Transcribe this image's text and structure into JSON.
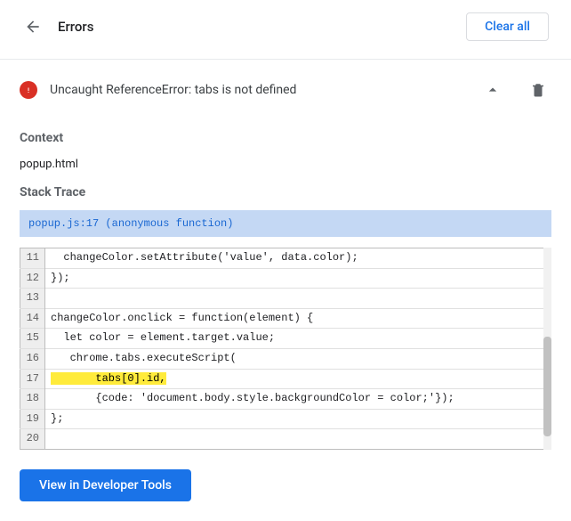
{
  "header": {
    "title": "Errors",
    "clear_all": "Clear all"
  },
  "error": {
    "message": "Uncaught ReferenceError: tabs is not defined",
    "context_heading": "Context",
    "context_file": "popup.html",
    "stack_heading": "Stack Trace",
    "stack_frame": "popup.js:17 (anonymous function)",
    "highlighted_line": 17,
    "code": [
      {
        "n": 11,
        "text": "  changeColor.setAttribute('value', data.color);",
        "hl": false
      },
      {
        "n": 12,
        "text": "});",
        "hl": false
      },
      {
        "n": 13,
        "text": "",
        "hl": false
      },
      {
        "n": 14,
        "text": "changeColor.onclick = function(element) {",
        "hl": false
      },
      {
        "n": 15,
        "text": "  let color = element.target.value;",
        "hl": false
      },
      {
        "n": 16,
        "text": "   chrome.tabs.executeScript(",
        "hl": false
      },
      {
        "n": 17,
        "text": "       tabs[0].id,",
        "hl": true
      },
      {
        "n": 18,
        "text": "       {code: 'document.body.style.backgroundColor = color;'});",
        "hl": false
      },
      {
        "n": 19,
        "text": "};",
        "hl": false
      },
      {
        "n": 20,
        "text": "",
        "hl": false
      }
    ]
  },
  "footer": {
    "view_devtools": "View in Developer Tools"
  }
}
